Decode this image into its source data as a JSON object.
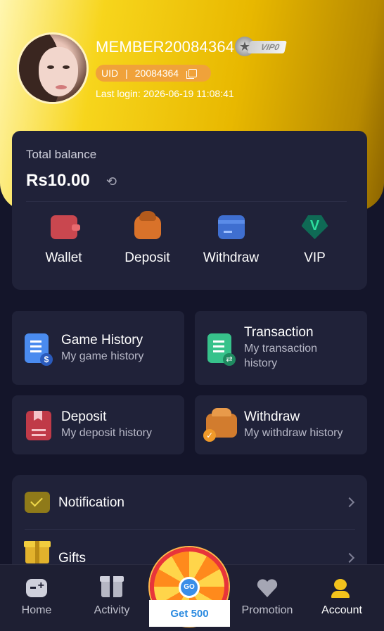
{
  "profile": {
    "username": "MEMBER20084364",
    "vip_label": "VIP0",
    "uid_label": "UID",
    "uid_value": "20084364",
    "last_login": "Last login: 2026-06-19 11:08:41"
  },
  "balance": {
    "label": "Total balance",
    "value": "Rs10.00",
    "actions": [
      {
        "label": "Wallet",
        "icon": "wallet-icon"
      },
      {
        "label": "Deposit",
        "icon": "deposit-icon"
      },
      {
        "label": "Withdraw",
        "icon": "withdraw-icon"
      },
      {
        "label": "VIP",
        "icon": "vip-icon",
        "glyph": "V"
      }
    ]
  },
  "tiles": {
    "game_history": {
      "title": "Game History",
      "subtitle": "My game history"
    },
    "transaction": {
      "title": "Transaction",
      "subtitle_line1": "My transaction",
      "subtitle_line2": "history"
    },
    "deposit": {
      "title": "Deposit",
      "subtitle": "My deposit history"
    },
    "withdraw": {
      "title": "Withdraw",
      "subtitle": "My withdraw history"
    }
  },
  "settings": {
    "notification": "Notification",
    "gifts": "Gifts"
  },
  "tabbar": {
    "home": "Home",
    "activity": "Activity",
    "get_label": "Get 500",
    "wheel_glyph": "GO",
    "promotion": "Promotion",
    "account": "Account"
  },
  "colors": {
    "background": "#14152a",
    "card": "#202239",
    "accent_gold": "#f2c21c",
    "uid_pill": "#f0a23a"
  }
}
